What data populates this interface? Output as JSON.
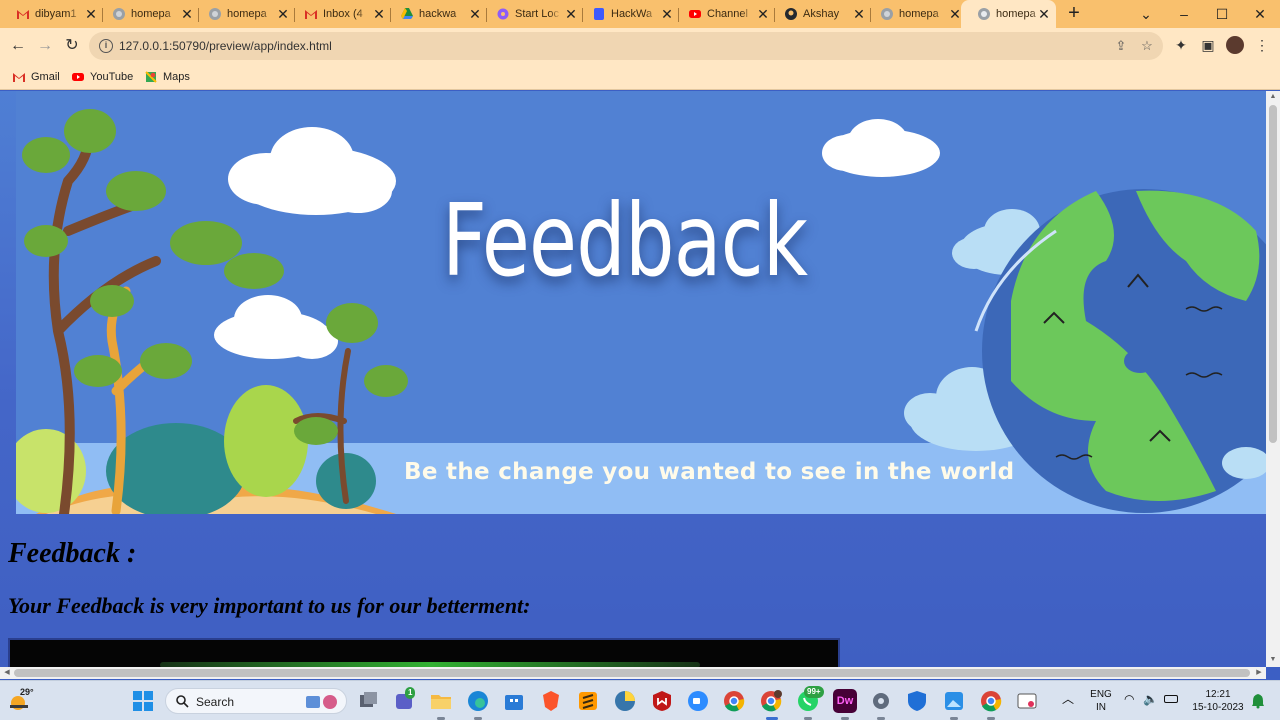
{
  "browser": {
    "tabs": [
      {
        "title": "dibyam1",
        "icon": "gmail-icon",
        "active": false
      },
      {
        "title": "homepa",
        "icon": "globe-icon",
        "active": false
      },
      {
        "title": "homepa",
        "icon": "globe-icon",
        "active": false
      },
      {
        "title": "Inbox (4",
        "icon": "gmail-icon",
        "active": false
      },
      {
        "title": "hackwa",
        "icon": "drive-icon",
        "active": false
      },
      {
        "title": "Start Loc",
        "icon": "gear-icon",
        "active": false
      },
      {
        "title": "HackWa",
        "icon": "doc-icon",
        "active": false
      },
      {
        "title": "Channel",
        "icon": "youtube-icon",
        "active": false
      },
      {
        "title": "Akshay",
        "icon": "github-icon",
        "active": false
      },
      {
        "title": "homepa",
        "icon": "globe-icon",
        "active": false
      },
      {
        "title": "homepa",
        "icon": "globe-icon",
        "active": true
      }
    ],
    "new_tab_symbol": "+",
    "address": "127.0.0.1:50790/preview/app/index.html",
    "bookmarks": [
      {
        "label": "Gmail",
        "icon": "gmail-icon"
      },
      {
        "label": "YouTube",
        "icon": "youtube-icon"
      },
      {
        "label": "Maps",
        "icon": "maps-icon"
      }
    ]
  },
  "page": {
    "banner_title": "Feedback",
    "banner_tagline": "Be the change you wanted to see in the world",
    "heading": "Feedback :",
    "subheading": "Your Feedback is very important to us for our betterment:"
  },
  "taskbar": {
    "temperature": "29°",
    "search_label": "Search",
    "teams_badge": "1",
    "whatsapp_badge": "99+",
    "dw_label": "Dw",
    "language": "ENG",
    "region": "IN",
    "time": "12:21",
    "date": "15-10-2023"
  },
  "colors": {
    "tabstrip": "#f9c06d",
    "toolbar": "#ffe7c4",
    "page_bg": "#4466c8",
    "banner_bg": "#5181d3"
  }
}
